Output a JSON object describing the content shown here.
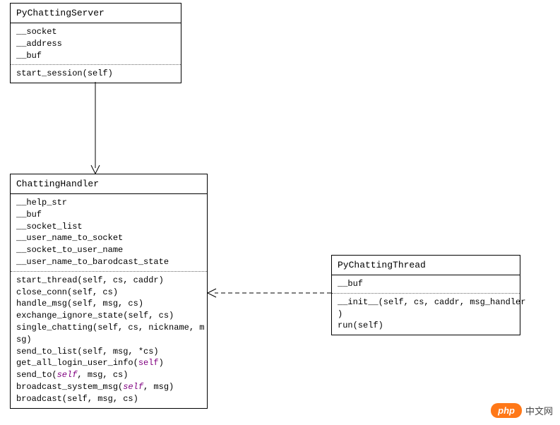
{
  "classes": {
    "server": {
      "name": "PyChattingServer",
      "attributes": [
        "__socket",
        "__address",
        "__buf"
      ],
      "methods": [
        "start_session(self)"
      ]
    },
    "handler": {
      "name": "ChattingHandler",
      "attributes": [
        "__help_str",
        "__buf",
        "__socket_list",
        "__user_name_to_socket",
        "__socket_to_user_name",
        "__user_name_to_barodcast_state"
      ],
      "methods": {
        "m0": "start_thread(self, cs, caddr)",
        "m1": "close_conn(self, cs)",
        "m2": "handle_msg(self, msg, cs)",
        "m3": "exchange_ignore_state(self, cs)",
        "m4": "single_chatting(self, cs, nickname, m",
        "m4b": "sg)",
        "m5": "send_to_list(self, msg, *cs)",
        "m6_pre": "get_all_login_user_info(",
        "m6_self": "self",
        "m6_post": ")",
        "m7_pre": "send_to(",
        "m7_self": "self",
        "m7_post": ", msg, cs)",
        "m8_pre": "broadcast_system_msg(",
        "m8_self": "self",
        "m8_post": ", msg)",
        "m9": "broadcast(self, msg, cs)"
      }
    },
    "thread": {
      "name": "PyChattingThread",
      "attributes": [
        "__buf"
      ],
      "methods": {
        "m0": "__init__(self, cs, caddr, msg_handler",
        "m0b": ")",
        "m1": "run(self)"
      }
    }
  },
  "watermark": {
    "logo": "php",
    "text": "中文网"
  }
}
